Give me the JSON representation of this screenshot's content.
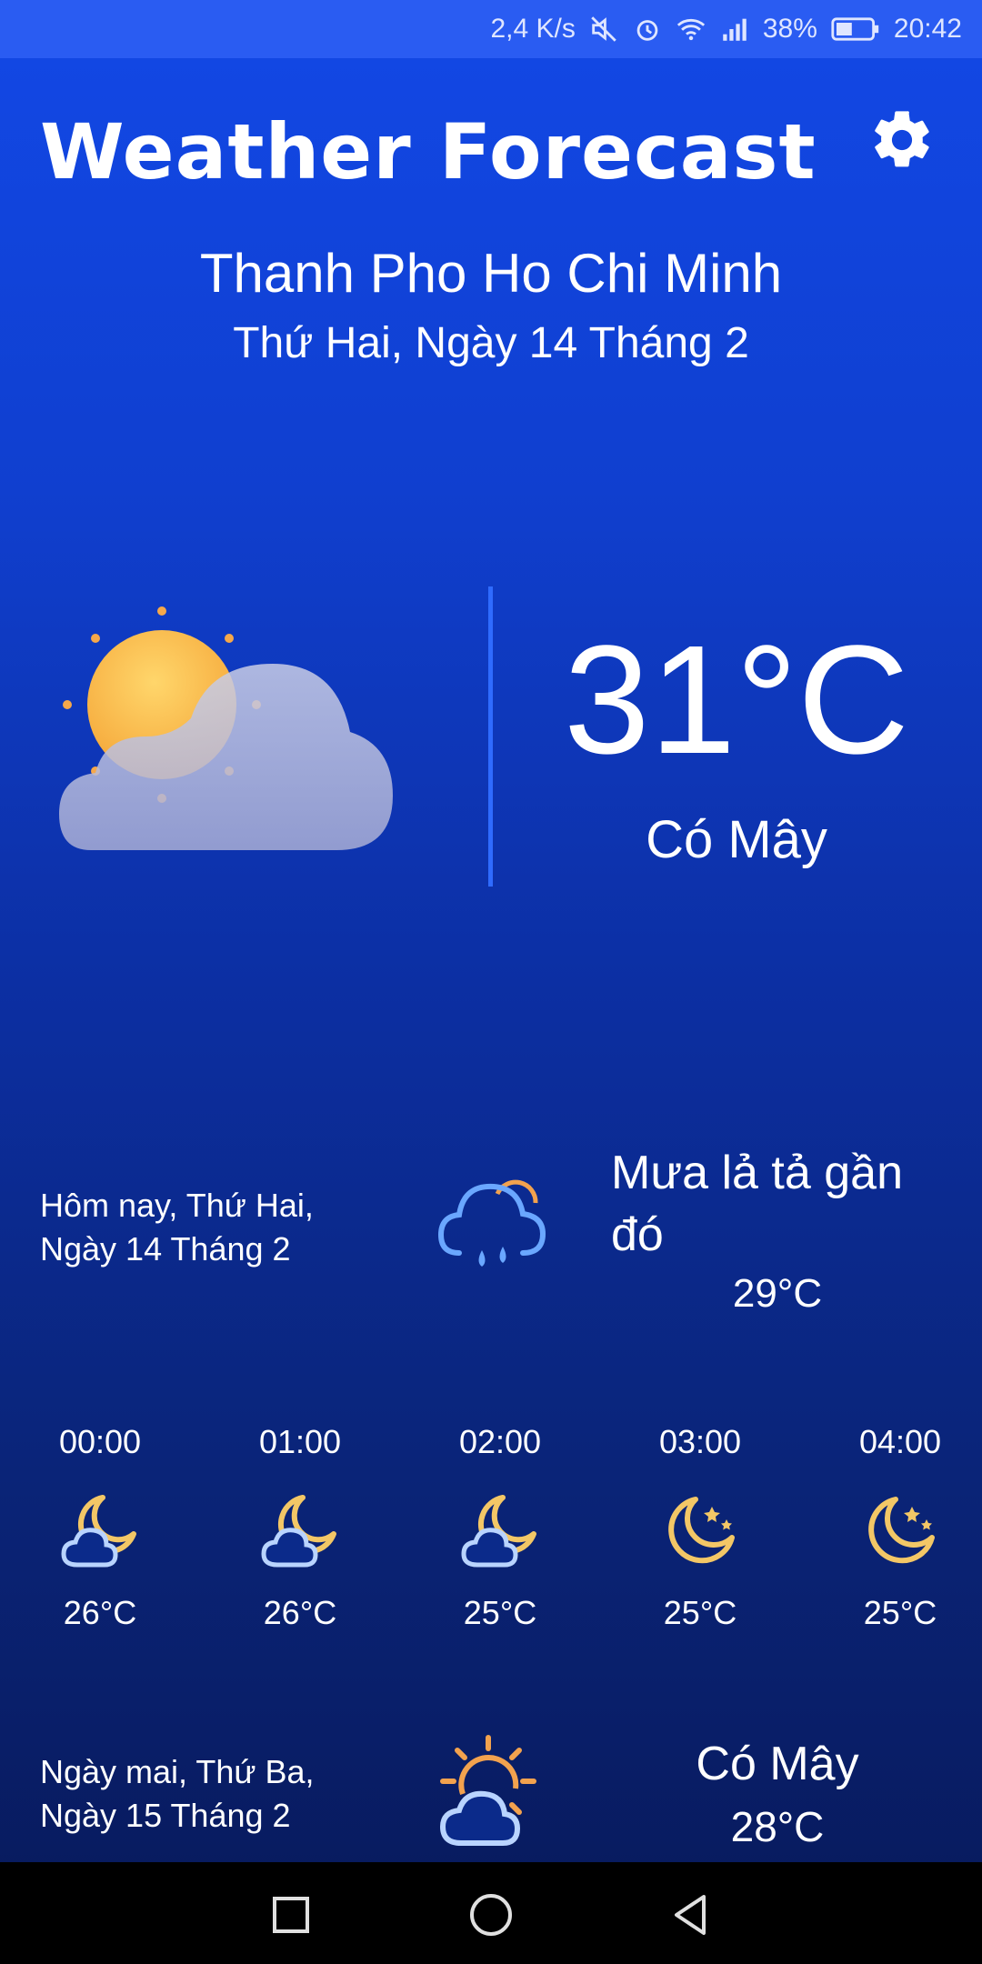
{
  "status_bar": {
    "speed": "2,4 K/s",
    "battery": "38%",
    "time": "20:42",
    "icons": [
      "mute-icon",
      "alarm-icon",
      "wifi-icon",
      "signal-icon",
      "battery-icon"
    ]
  },
  "header": {
    "title": "Weather Forecast",
    "settings_icon": "gear-icon"
  },
  "location": {
    "city": "Thanh Pho Ho Chi Minh",
    "date": "Thứ Hai, Ngày 14 Tháng 2"
  },
  "current": {
    "icon": "partly-cloudy-sun-icon",
    "temperature": "31°C",
    "description": "Có Mây"
  },
  "today": {
    "label_line1": "Hôm nay, Thứ Hai,",
    "label_line2": "Ngày 14 Tháng 2",
    "icon": "rain-cloud-icon",
    "description": "Mưa lả tả gần đó",
    "temperature": "29°C"
  },
  "hourly": [
    {
      "time": "00:00",
      "icon": "cloudy-moon-icon",
      "temp": "26°C"
    },
    {
      "time": "01:00",
      "icon": "cloudy-moon-icon",
      "temp": "26°C"
    },
    {
      "time": "02:00",
      "icon": "cloudy-moon-icon",
      "temp": "25°C"
    },
    {
      "time": "03:00",
      "icon": "moon-stars-icon",
      "temp": "25°C"
    },
    {
      "time": "04:00",
      "icon": "moon-stars-icon",
      "temp": "25°C"
    }
  ],
  "tomorrow": {
    "label_line1": "Ngày mai, Thứ Ba,",
    "label_line2": "Ngày 15 Tháng 2",
    "icon": "sun-cloud-icon",
    "description": "Có Mây",
    "temperature": "28°C"
  },
  "nav": [
    "recent-apps-icon",
    "home-icon",
    "back-icon"
  ],
  "colors": {
    "accent": "#2f6bff",
    "sun": "#f6b84a",
    "moon": "#f3c766",
    "cloud_outline": "#7fb3ff"
  }
}
